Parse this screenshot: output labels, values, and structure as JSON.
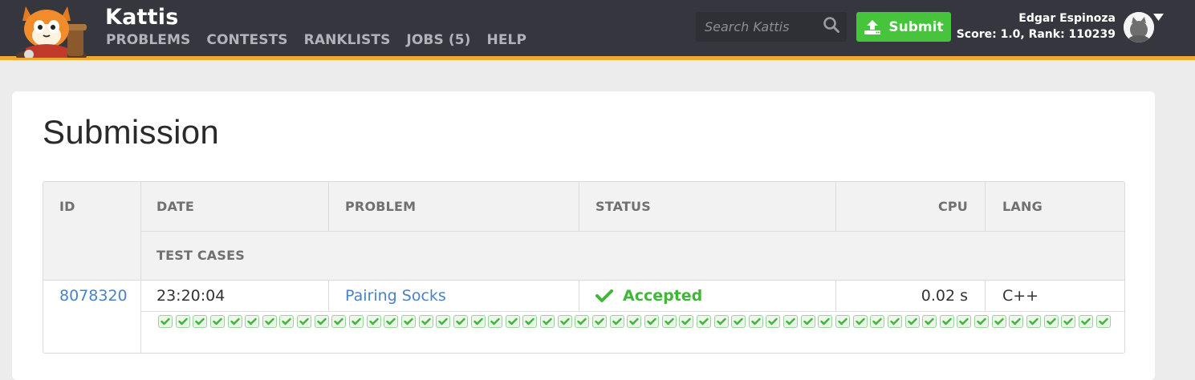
{
  "header": {
    "brand": "Kattis",
    "nav": [
      "PROBLEMS",
      "CONTESTS",
      "RANKLISTS",
      "JOBS (5)",
      "HELP"
    ],
    "search_placeholder": "Search Kattis",
    "submit_label": "Submit",
    "user_name": "Edgar Espinoza",
    "user_score": "Score: 1.0, Rank: 110239",
    "accent_color": "#f1aa31",
    "bar_color": "#36363e",
    "icons": [
      "kattis-cat-logo-icon",
      "search-icon",
      "upload-icon",
      "user-avatar-icon",
      "caret-down-icon"
    ]
  },
  "page": {
    "title": "Submission"
  },
  "table": {
    "headers": {
      "id": "ID",
      "date": "DATE",
      "problem": "PROBLEM",
      "status": "STATUS",
      "cpu": "CPU",
      "lang": "LANG",
      "test_cases": "TEST CASES"
    },
    "row": {
      "id": "8078320",
      "date": "23:20:04",
      "problem": "Pairing Socks",
      "status": "Accepted",
      "cpu": "0.02 s",
      "lang": "C++"
    },
    "test_cases": {
      "total": 55,
      "passed": 55,
      "status_color": "#43b63a"
    }
  }
}
